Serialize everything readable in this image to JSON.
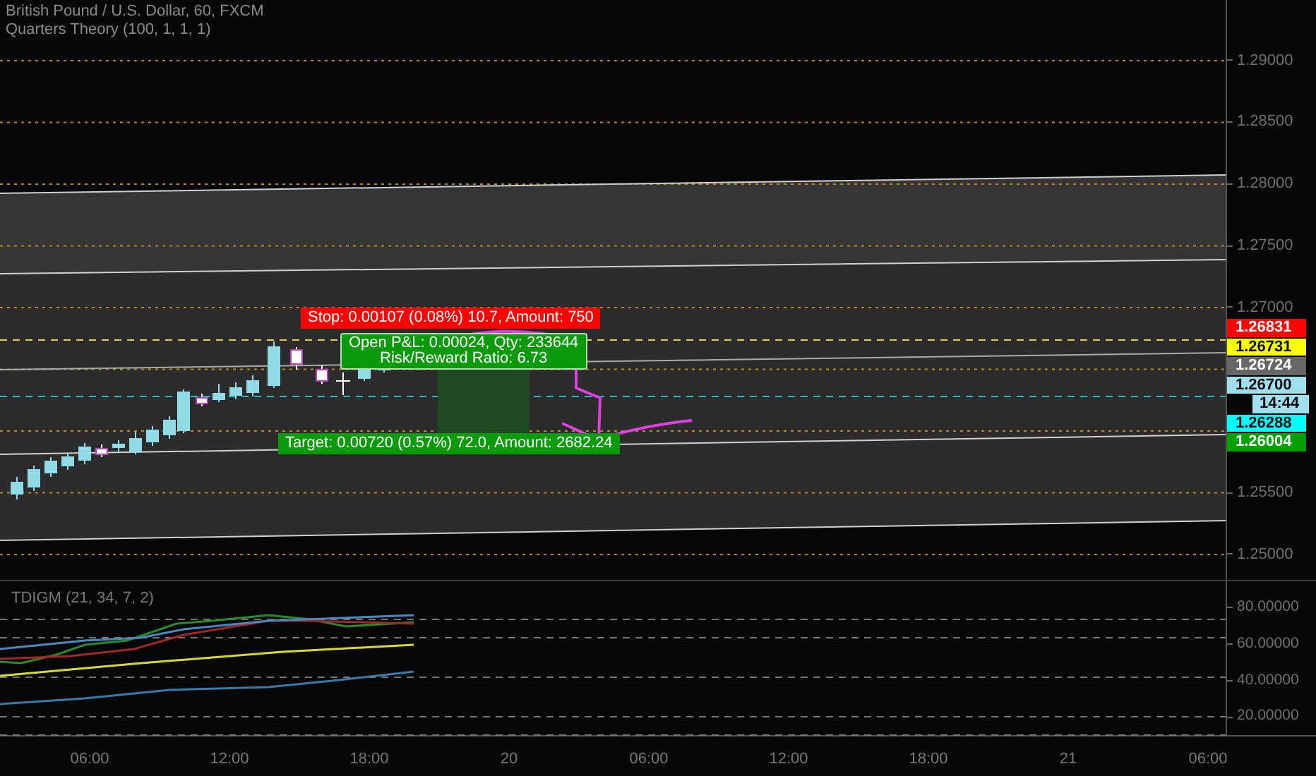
{
  "header": {
    "symbol": "British Pound / U.S. Dollar, 60, FXCM",
    "indicator": "Quarters Theory (100, 1, 1, 1)"
  },
  "position": {
    "stop": "Stop: 0.00107 (0.08%) 10.7, Amount: 750",
    "open_pnl": "Open P&L: 0.00024, Qty: 233644",
    "risk_reward": "Risk/Reward Ratio: 6.73",
    "target": "Target: 0.00720 (0.57%) 72.0, Amount: 2682.24"
  },
  "price_axis": {
    "ticks": [
      "1.29000",
      "1.28500",
      "1.28000",
      "1.27500",
      "1.27000",
      "1.25500",
      "1.25000"
    ],
    "labels": [
      {
        "kind": "price",
        "text": "1.26831",
        "color": "#ff0000"
      },
      {
        "kind": "price",
        "text": "1.26731",
        "color": "#ffff00"
      },
      {
        "kind": "price",
        "text": "1.26724",
        "color": "#666666"
      },
      {
        "kind": "price",
        "text": "1.26700",
        "color": "#9fdfee"
      },
      {
        "kind": "countdown",
        "text": "14:44",
        "color": "#9fdfee"
      },
      {
        "kind": "price",
        "text": "1.26288",
        "color": "#00ffff"
      },
      {
        "kind": "price",
        "text": "1.26004",
        "color": "#00a000"
      }
    ]
  },
  "indicator_pane": {
    "title": "TDIGM (21, 34, 7, 2)",
    "ticks": [
      "80.00000",
      "60.00000",
      "40.00000",
      "20.00000"
    ]
  },
  "time_axis": [
    "06:00",
    "12:00",
    "18:00",
    "20",
    "06:00",
    "12:00",
    "18:00",
    "21",
    "06:00"
  ]
}
